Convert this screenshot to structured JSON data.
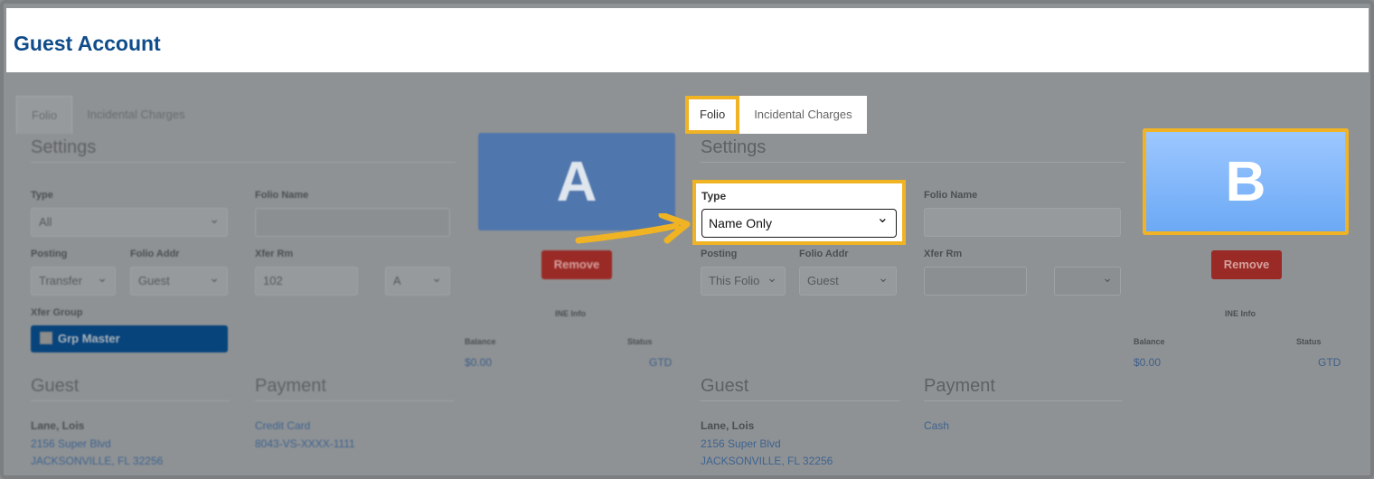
{
  "page": {
    "title": "Guest Account"
  },
  "colors": {
    "accent": "#f0b323",
    "brand": "#0f4c8a",
    "danger": "#9a2a26"
  },
  "pane_a": {
    "tabs": [
      "Folio",
      "Incidental Charges"
    ],
    "settings_title": "Settings",
    "type_label": "Type",
    "type_value": "All",
    "folio_name_label": "Folio Name",
    "folio_name_value": "",
    "posting_label": "Posting",
    "posting_value": "Transfer",
    "folio_addr_label": "Folio Addr",
    "folio_addr_value": "Guest",
    "xfer_rm_label": "Xfer Rm",
    "xfer_rm_value": "102",
    "xfer_rm_select": "A",
    "xfer_group_label": "Xfer Group",
    "xfer_group_button": "Grp Master",
    "card_letter": "A",
    "remove_label": "Remove",
    "ine_info": "INE Info",
    "balance_label": "Balance",
    "balance_value": "$0.00",
    "status_label": "Status",
    "status_value": "GTD",
    "guest_title": "Guest",
    "guest_name": "Lane, Lois",
    "guest_addr1": "2156 Super Blvd",
    "guest_addr2": "JACKSONVILLE, FL 32256",
    "payment_title": "Payment",
    "payment_method": "Credit Card",
    "payment_card": "8043-VS-XXXX-1111"
  },
  "pane_b": {
    "tabs": [
      "Folio",
      "Incidental Charges"
    ],
    "settings_title": "Settings",
    "type_label": "Type",
    "type_value": "Name Only",
    "folio_name_label": "Folio Name",
    "folio_name_value": "",
    "posting_label": "Posting",
    "posting_value": "This Folio",
    "folio_addr_label": "Folio Addr",
    "folio_addr_value": "Guest",
    "xfer_rm_label": "Xfer Rm",
    "xfer_rm_value": "",
    "xfer_rm_select": "",
    "card_letter": "B",
    "remove_label": "Remove",
    "ine_info": "INE Info",
    "balance_label": "Balance",
    "balance_value": "$0.00",
    "status_label": "Status",
    "status_value": "GTD",
    "guest_title": "Guest",
    "guest_name": "Lane, Lois",
    "guest_addr1": "2156 Super Blvd",
    "guest_addr2": "JACKSONVILLE, FL 32256",
    "payment_title": "Payment",
    "payment_method": "Cash"
  },
  "icons": {
    "arrow": "arrow-right-icon",
    "dropdown": "chevron-down-icon",
    "checkbox": "checkbox-icon"
  }
}
